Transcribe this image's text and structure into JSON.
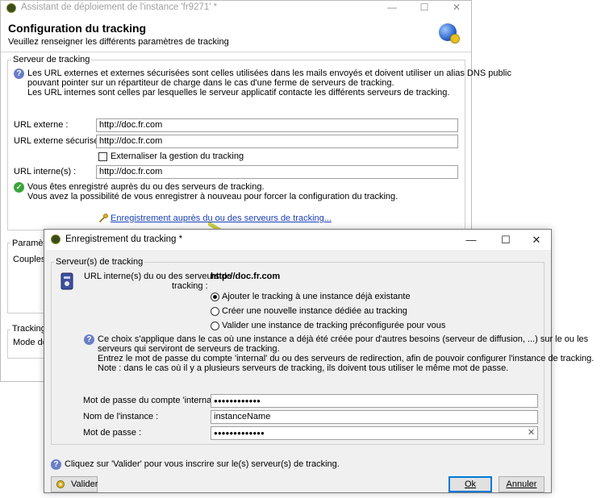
{
  "main_window": {
    "title": "Assistant de déploiement de l'instance 'fr9271' *",
    "header_title": "Configuration du tracking",
    "header_subtitle": "Veuillez renseigner les différents paramètres de tracking",
    "tracking_server_group": {
      "label": "Serveur de tracking",
      "info_line1": "Les URL externes et externes sécurisées sont celles utilisées dans les mails envoyés et doivent utiliser un alias DNS public",
      "info_line2": "pouvant pointer sur un répartiteur de charge dans le cas d'une ferme de serveurs de tracking.",
      "info_line3": "Les URL internes sont celles par lesquelles le serveur applicatif contacte les différents serveurs de tracking.",
      "external_url_label": "URL externe :",
      "external_url_value": "http://doc.fr.com",
      "secure_url_label": "URL externe sécurisée :",
      "secure_url_value": "http://doc.fr.com",
      "externalize_label": "Externaliser la gestion du tracking",
      "internal_url_label": "URL interne(s) :",
      "internal_url_value": "http://doc.fr.com",
      "registered_line1": "Vous êtes enregistré auprès du ou des serveurs de tracking.",
      "registered_line2": "Vous avez la possibilité de vous enregistrer à nouveau pour forcer la configuration du tracking.",
      "register_link": "Enregistrement auprès du ou des serveurs de tracking..."
    },
    "params_group_label": "Paramètre",
    "couples_label": "Couples d",
    "tracking_group_label": "Tracking V",
    "mode_label": "Mode de"
  },
  "dialog": {
    "title": "Enregistrement du tracking *",
    "servers_group_label": "Serveur(s) de tracking",
    "internal_url_label_line1": "URL interne(s) du ou des serveurs de",
    "internal_url_label_line2": "tracking :",
    "internal_url_value": "http://doc.fr.com",
    "radio_options": [
      {
        "label": "Ajouter le tracking à une instance déjà existante",
        "selected": true
      },
      {
        "label": "Créer une nouvelle instance dédiée au tracking",
        "selected": false
      },
      {
        "label": "Valider une instance de tracking préconfigurée pour vous",
        "selected": false
      }
    ],
    "info_line1": "Ce choix s'applique dans le cas où une instance a déjà été créée pour d'autres besoins (serveur de diffusion, ...) sur le ou les",
    "info_line2": "serveurs qui serviront de serveurs de tracking.",
    "info_line3": "Entrez le mot de passe du compte 'internal' du ou des serveurs de redirection, afin de pouvoir configurer l'instance de tracking.",
    "info_line4": "Note : dans le cas où il y a plusieurs serveurs de tracking, ils doivent tous utiliser le même mot de passe.",
    "internal_password_label": "Mot de passe du compte 'internal' :",
    "internal_password_value": "●●●●●●●●●●●●",
    "instance_name_label": "Nom de l'instance :",
    "instance_name_value": "instanceName",
    "password_label": "Mot de passe :",
    "password_value": "●●●●●●●●●●●●●",
    "footer_hint": "Cliquez sur 'Valider' pour vous inscrire sur le(s) serveur(s) de tracking.",
    "validate_button": "Valider",
    "ok_button": "Ok",
    "cancel_button": "Annuler",
    "clear_icon_glyph": "✕"
  },
  "window_controls": {
    "minimize": "—",
    "maximize": "☐",
    "close": "✕"
  },
  "colors": {
    "link": "#1a3fb8",
    "arrow": "#b8c23a",
    "default_button_border": "#0078d7"
  }
}
